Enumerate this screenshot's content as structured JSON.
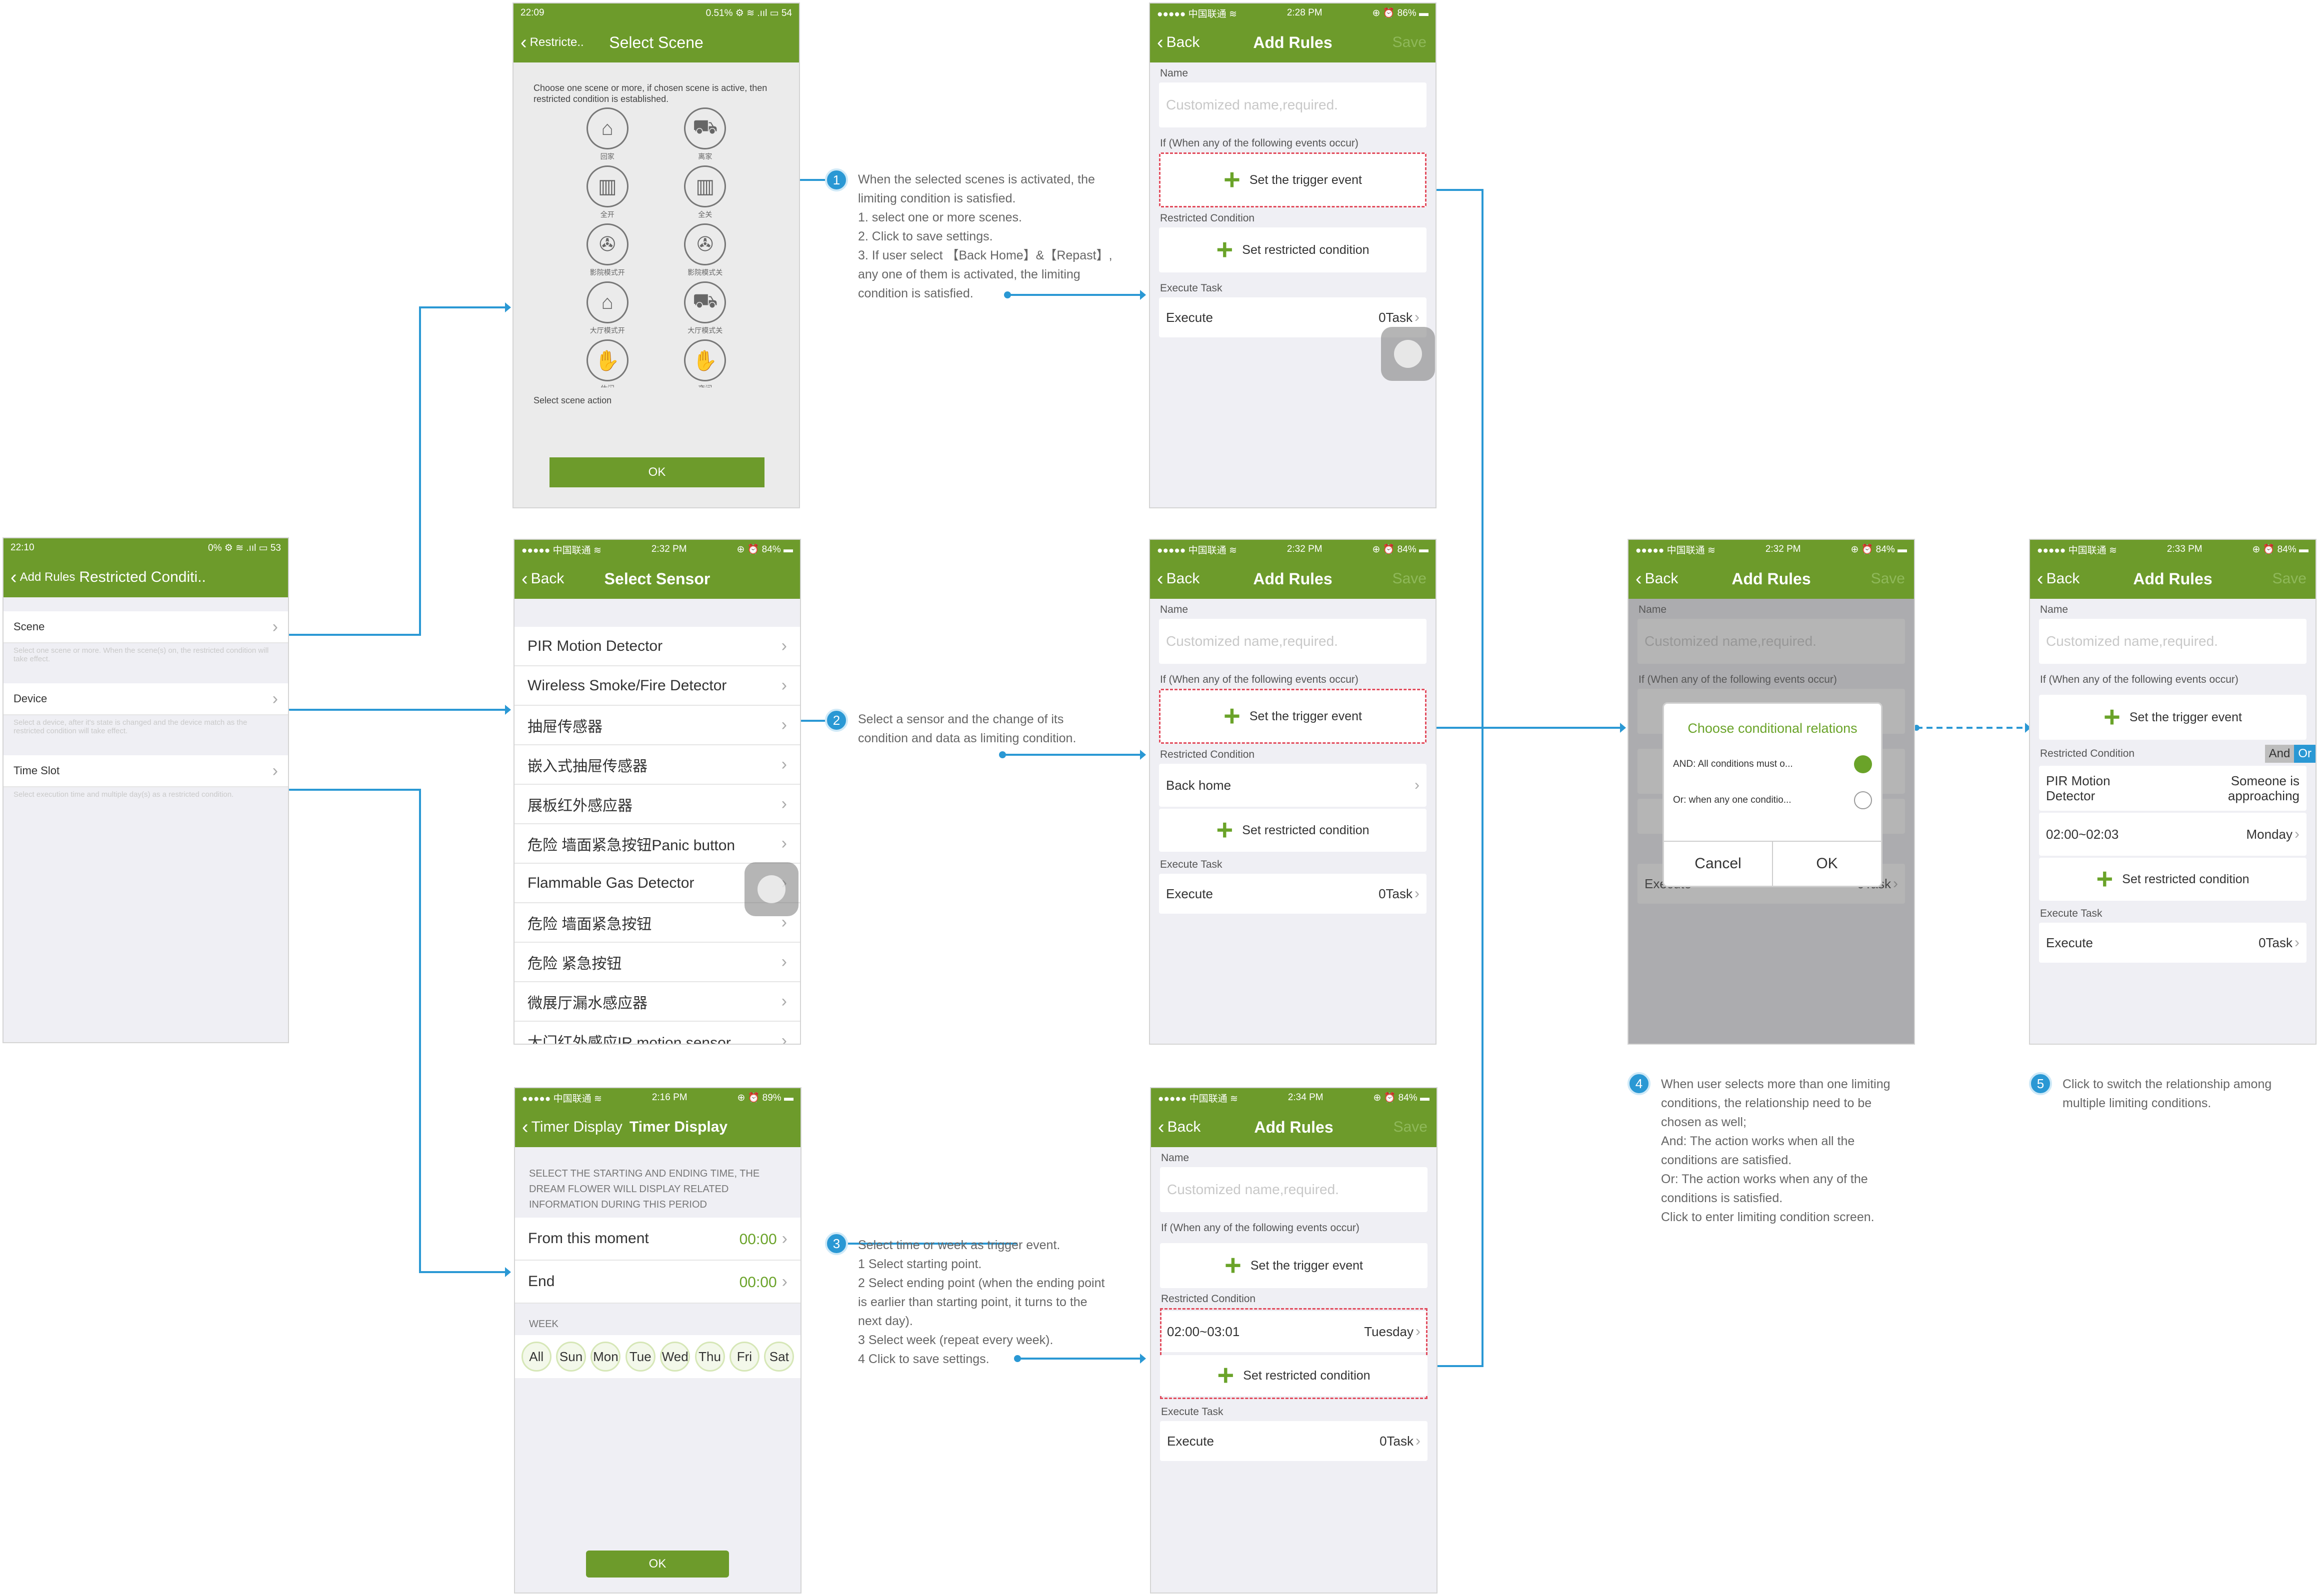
{
  "restricted_screen": {
    "status_time": "22:10",
    "status_right": "0% ⚙ ≋ .ııl ▭ 53",
    "back_label": "Add Rules",
    "title": "Restricted Conditi..",
    "rows": [
      {
        "label": "Scene",
        "desc": "Select one scene or more. When the scene(s) on, the restricted condition will take effect."
      },
      {
        "label": "Device",
        "desc": "Select a device, after it's state is changed and the device match as the restricted condition will take effect."
      },
      {
        "label": "Time Slot",
        "desc": "Select execution time and multiple day(s) as a restricted condition."
      }
    ]
  },
  "scene_screen": {
    "status_time": "22:09",
    "status_right": "0.51% ⚙ ≋ .ııl ▭ 54",
    "back_label": "Restricte..",
    "title": "Select Scene",
    "instruction": "Choose one scene or more, if chosen scene is active, then restricted condition is established.",
    "scenes": [
      "回家",
      "离家",
      "全开",
      "全关",
      "影院模式开",
      "影院模式关",
      "大厅模式开",
      "大厅模式关",
      "休闲",
      "夜间"
    ],
    "footer_text": "Select scene action",
    "ok_label": "OK"
  },
  "sensor_screen": {
    "status_left": "●●●●● 中国联通 ≋",
    "status_time": "2:32 PM",
    "status_right": "⊕ ⏰ 84% ▬",
    "back_label": "Back",
    "title": "Select Sensor",
    "sensors": [
      "PIR Motion Detector",
      "Wireless Smoke/Fire Detector",
      "抽屉传感器",
      "嵌入式抽屉传感器",
      "展板红外感应器",
      "危险 墙面紧急按钮Panic button",
      "Flammable Gas Detector",
      "危险 墙面紧急按钮",
      "危险 紧急按钮",
      "微展厅漏水感应器",
      "大门红外感应IR motion sensor"
    ]
  },
  "timer_screen": {
    "status_left": "●●●●● 中国联通 ≋",
    "status_time": "2:16 PM",
    "status_right": "⊕ ⏰ 89% ▬",
    "back_label": "Timer Display",
    "title": "Timer Display",
    "instruction": "SELECT THE STARTING AND ENDING TIME, THE DREAM FLOWER WILL DISPLAY RELATED INFORMATION DURING THIS PERIOD",
    "from_label": "From this moment",
    "from_value": "00:00",
    "end_label": "End",
    "end_value": "00:00",
    "week_label": "WEEK",
    "days": [
      "All",
      "Sun",
      "Mon",
      "Tue",
      "Wed",
      "Thu",
      "Fri",
      "Sat"
    ],
    "ok_label": "OK"
  },
  "add_rules_1": {
    "status_left": "●●●●● 中国联通 ≋",
    "status_time": "2:28 PM",
    "status_right": "⊕ ⏰ 86% ▬",
    "back_label": "Back",
    "title": "Add Rules",
    "save_label": "Save",
    "name_label": "Name",
    "name_placeholder": "Customized name,required.",
    "if_label": "If (When any of the following events occur)",
    "trigger_label": "Set the trigger event",
    "restricted_label": "Restricted Condition",
    "set_restricted_label": "Set restricted condition",
    "execute_task_label": "Execute Task",
    "execute_label": "Execute",
    "execute_value": "0Task"
  },
  "add_rules_2": {
    "status_left": "●●●●● 中国联通 ≋",
    "status_time": "2:32 PM",
    "status_right": "⊕ ⏰ 84% ▬",
    "back_label": "Back",
    "title": "Add Rules",
    "save_label": "Save",
    "name_label": "Name",
    "name_placeholder": "Customized name,required.",
    "if_label": "If (When any of the following events occur)",
    "trigger_label": "Set the trigger event",
    "restricted_label": "Restricted Condition",
    "condition_item": "Back home",
    "set_restricted_label": "Set restricted condition",
    "execute_task_label": "Execute Task",
    "execute_label": "Execute",
    "execute_value": "0Task"
  },
  "add_rules_3": {
    "status_left": "●●●●● 中国联通 ≋",
    "status_time": "2:34 PM",
    "status_right": "⊕ ⏰ 84% ▬",
    "back_label": "Back",
    "title": "Add Rules",
    "save_label": "Save",
    "name_label": "Name",
    "name_placeholder": "Customized name,required.",
    "if_label": "If (When any of the following events occur)",
    "trigger_label": "Set the trigger event",
    "restricted_label": "Restricted Condition",
    "condition_time": "02:00~03:01",
    "condition_day": "Tuesday",
    "set_restricted_label": "Set restricted condition",
    "execute_task_label": "Execute Task",
    "execute_label": "Execute",
    "execute_value": "0Task"
  },
  "dialog_screen": {
    "status_left": "●●●●● 中国联通 ≋",
    "status_time": "2:32 PM",
    "status_right": "⊕ ⏰ 84% ▬",
    "back_label": "Back",
    "title": "Add Rules",
    "save_label": "Save",
    "name_label": "Name",
    "name_placeholder": "Customized name,required.",
    "if_label": "If (When any of the following events occur)",
    "execute_label": "Execute",
    "execute_value": "0Task",
    "dialog_title": "Choose conditional relations",
    "option_and": "AND: All conditions must o...",
    "option_or": "Or: when any one conditio...",
    "cancel_label": "Cancel",
    "ok_label": "OK"
  },
  "final_screen": {
    "status_left": "●●●●● 中国联通 ≋",
    "status_time": "2:33 PM",
    "status_right": "⊕ ⏰ 84% ▬",
    "back_label": "Back",
    "title": "Add Rules",
    "save_label": "Save",
    "name_label": "Name",
    "name_placeholder": "Customized name,required.",
    "if_label": "If (When any of the following events occur)",
    "trigger_label": "Set the trigger event",
    "restricted_label": "Restricted Condition",
    "toggle_and": "And",
    "toggle_or": "Or",
    "cond1_left": "PIR Motion\nDetector",
    "cond1_right": "Someone is\napproaching",
    "cond2_left": "02:00~02:03",
    "cond2_right": "Monday",
    "set_restricted_label": "Set restricted condition",
    "execute_task_label": "Execute Task",
    "execute_label": "Execute",
    "execute_value": "0Task"
  },
  "notes": [
    {
      "num": "1",
      "text": "When the selected scenes is activated, the\nlimiting condition is satisfied.\n1. select one or more scenes.\n2. Click to save settings.\n3. If user select 【Back Home】&【Repast】,\nany one of them is activated, the limiting\ncondition is satisfied."
    },
    {
      "num": "2",
      "text": "Select a sensor and the change of its\ncondition and data as limiting condition."
    },
    {
      "num": "3",
      "text": "Select time or week as trigger event.\n1 Select starting point.\n2 Select ending point (when the ending point\nis earlier than starting point, it turns to the\nnext day).\n3 Select week (repeat every week).\n4 Click to save settings."
    },
    {
      "num": "4",
      "text": "When user selects more than one limiting\nconditions, the relationship need to be\nchosen as well;\nAnd: The action works when all the\nconditions are satisfied.\nOr: The action works when any of the\nconditions is satisfied.\nClick to enter limiting condition screen."
    },
    {
      "num": "5",
      "text": "Click to switch the relationship among\nmultiple limiting conditions."
    }
  ],
  "colors": {
    "brand_green": "#6d9b2b",
    "connector_blue": "#2a98d4",
    "highlight_red": "#e24b5c"
  }
}
